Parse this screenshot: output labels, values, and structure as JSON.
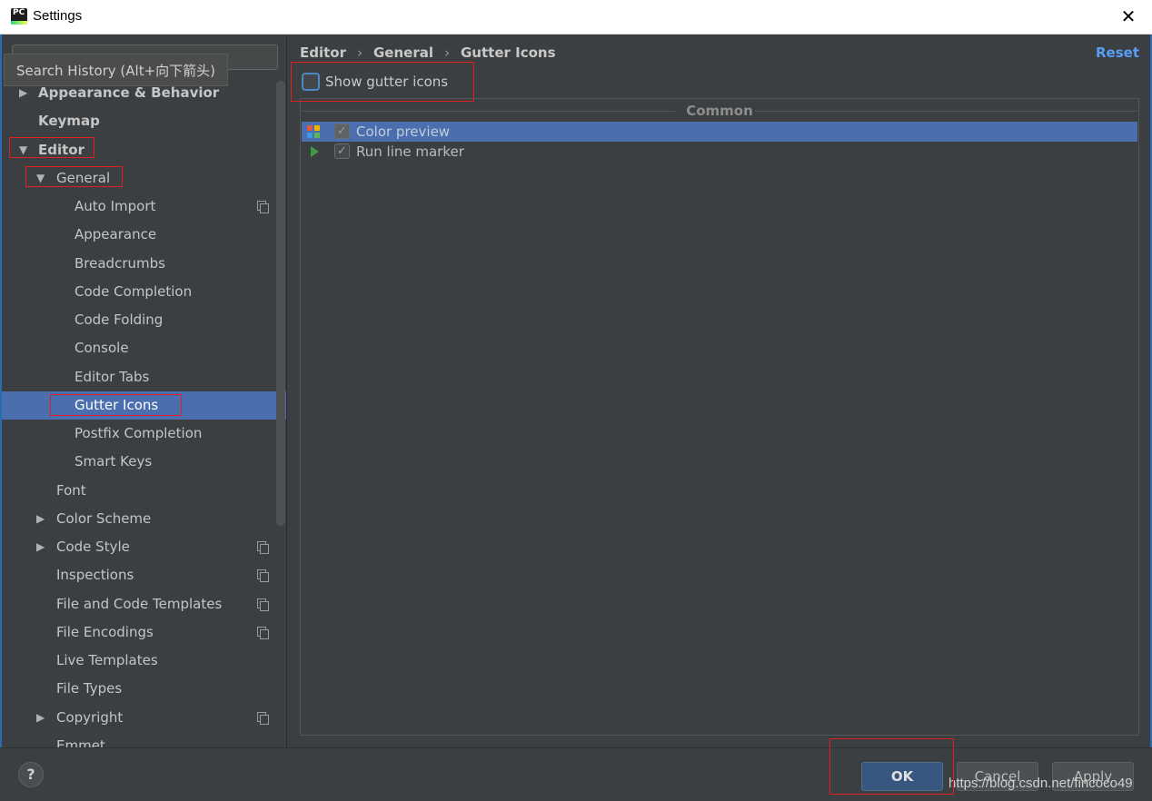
{
  "window": {
    "title": "Settings",
    "close_glyph": "✕"
  },
  "search": {
    "tooltip": "Search History (Alt+向下箭头)"
  },
  "tree": [
    {
      "label": "Appearance & Behavior",
      "arrow": "▶",
      "bold": true,
      "level": 0
    },
    {
      "label": "Keymap",
      "arrow": "",
      "bold": true,
      "level": 0
    },
    {
      "label": "Editor",
      "arrow": "▼",
      "bold": true,
      "level": 0
    },
    {
      "label": "General",
      "arrow": "▼",
      "bold": false,
      "level": 1
    },
    {
      "label": "Auto Import",
      "arrow": "",
      "bold": false,
      "level": 2,
      "copy": true
    },
    {
      "label": "Appearance",
      "arrow": "",
      "bold": false,
      "level": 2
    },
    {
      "label": "Breadcrumbs",
      "arrow": "",
      "bold": false,
      "level": 2
    },
    {
      "label": "Code Completion",
      "arrow": "",
      "bold": false,
      "level": 2
    },
    {
      "label": "Code Folding",
      "arrow": "",
      "bold": false,
      "level": 2
    },
    {
      "label": "Console",
      "arrow": "",
      "bold": false,
      "level": 2
    },
    {
      "label": "Editor Tabs",
      "arrow": "",
      "bold": false,
      "level": 2
    },
    {
      "label": "Gutter Icons",
      "arrow": "",
      "bold": false,
      "level": 2,
      "selected": true
    },
    {
      "label": "Postfix Completion",
      "arrow": "",
      "bold": false,
      "level": 2
    },
    {
      "label": "Smart Keys",
      "arrow": "",
      "bold": false,
      "level": 2
    },
    {
      "label": "Font",
      "arrow": "",
      "bold": false,
      "level": 1
    },
    {
      "label": "Color Scheme",
      "arrow": "▶",
      "bold": false,
      "level": 1
    },
    {
      "label": "Code Style",
      "arrow": "▶",
      "bold": false,
      "level": 1,
      "copy": true
    },
    {
      "label": "Inspections",
      "arrow": "",
      "bold": false,
      "level": 1,
      "copy": true
    },
    {
      "label": "File and Code Templates",
      "arrow": "",
      "bold": false,
      "level": 1,
      "copy": true
    },
    {
      "label": "File Encodings",
      "arrow": "",
      "bold": false,
      "level": 1,
      "copy": true
    },
    {
      "label": "Live Templates",
      "arrow": "",
      "bold": false,
      "level": 1
    },
    {
      "label": "File Types",
      "arrow": "",
      "bold": false,
      "level": 1
    },
    {
      "label": "Copyright",
      "arrow": "▶",
      "bold": false,
      "level": 1,
      "copy": true
    },
    {
      "label": "Emmet",
      "arrow": "",
      "bold": false,
      "level": 1
    }
  ],
  "breadcrumb": {
    "items": [
      "Editor",
      "General",
      "Gutter Icons"
    ],
    "separator": "›"
  },
  "reset_label": "Reset",
  "show_gutter_label": "Show gutter icons",
  "show_gutter_checked": false,
  "section": {
    "title": "Common",
    "items": [
      {
        "label": "Color preview",
        "checked": true,
        "icon": "color-grid-icon",
        "selected": true
      },
      {
        "label": "Run line marker",
        "checked": true,
        "icon": "run-arrow-icon",
        "selected": false
      }
    ]
  },
  "buttons": {
    "help": "?",
    "ok": "OK",
    "cancel": "Cancel",
    "apply": "Apply"
  },
  "watermark": "https://blog.csdn.net/fincoco49",
  "colors": {
    "selection": "#4b6eaf",
    "accent_link": "#589df6",
    "annotation": "#e02020",
    "ok_button": "#365880"
  }
}
